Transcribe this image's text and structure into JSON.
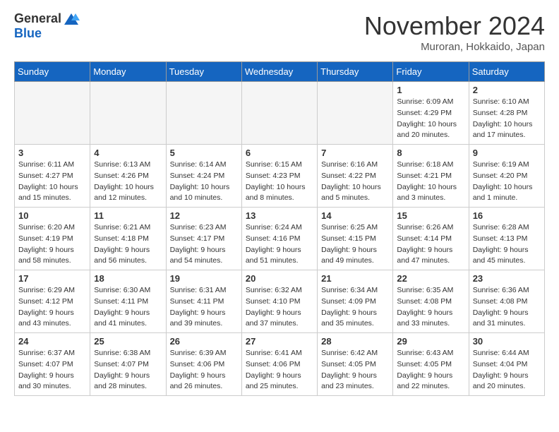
{
  "header": {
    "logo_general": "General",
    "logo_blue": "Blue",
    "month_title": "November 2024",
    "location": "Muroran, Hokkaido, Japan"
  },
  "weekdays": [
    "Sunday",
    "Monday",
    "Tuesday",
    "Wednesday",
    "Thursday",
    "Friday",
    "Saturday"
  ],
  "weeks": [
    [
      {
        "day": "",
        "info": "",
        "empty": true
      },
      {
        "day": "",
        "info": "",
        "empty": true
      },
      {
        "day": "",
        "info": "",
        "empty": true
      },
      {
        "day": "",
        "info": "",
        "empty": true
      },
      {
        "day": "",
        "info": "",
        "empty": true
      },
      {
        "day": "1",
        "info": "Sunrise: 6:09 AM\nSunset: 4:29 PM\nDaylight: 10 hours\nand 20 minutes.",
        "empty": false
      },
      {
        "day": "2",
        "info": "Sunrise: 6:10 AM\nSunset: 4:28 PM\nDaylight: 10 hours\nand 17 minutes.",
        "empty": false
      }
    ],
    [
      {
        "day": "3",
        "info": "Sunrise: 6:11 AM\nSunset: 4:27 PM\nDaylight: 10 hours\nand 15 minutes.",
        "empty": false
      },
      {
        "day": "4",
        "info": "Sunrise: 6:13 AM\nSunset: 4:26 PM\nDaylight: 10 hours\nand 12 minutes.",
        "empty": false
      },
      {
        "day": "5",
        "info": "Sunrise: 6:14 AM\nSunset: 4:24 PM\nDaylight: 10 hours\nand 10 minutes.",
        "empty": false
      },
      {
        "day": "6",
        "info": "Sunrise: 6:15 AM\nSunset: 4:23 PM\nDaylight: 10 hours\nand 8 minutes.",
        "empty": false
      },
      {
        "day": "7",
        "info": "Sunrise: 6:16 AM\nSunset: 4:22 PM\nDaylight: 10 hours\nand 5 minutes.",
        "empty": false
      },
      {
        "day": "8",
        "info": "Sunrise: 6:18 AM\nSunset: 4:21 PM\nDaylight: 10 hours\nand 3 minutes.",
        "empty": false
      },
      {
        "day": "9",
        "info": "Sunrise: 6:19 AM\nSunset: 4:20 PM\nDaylight: 10 hours\nand 1 minute.",
        "empty": false
      }
    ],
    [
      {
        "day": "10",
        "info": "Sunrise: 6:20 AM\nSunset: 4:19 PM\nDaylight: 9 hours\nand 58 minutes.",
        "empty": false
      },
      {
        "day": "11",
        "info": "Sunrise: 6:21 AM\nSunset: 4:18 PM\nDaylight: 9 hours\nand 56 minutes.",
        "empty": false
      },
      {
        "day": "12",
        "info": "Sunrise: 6:23 AM\nSunset: 4:17 PM\nDaylight: 9 hours\nand 54 minutes.",
        "empty": false
      },
      {
        "day": "13",
        "info": "Sunrise: 6:24 AM\nSunset: 4:16 PM\nDaylight: 9 hours\nand 51 minutes.",
        "empty": false
      },
      {
        "day": "14",
        "info": "Sunrise: 6:25 AM\nSunset: 4:15 PM\nDaylight: 9 hours\nand 49 minutes.",
        "empty": false
      },
      {
        "day": "15",
        "info": "Sunrise: 6:26 AM\nSunset: 4:14 PM\nDaylight: 9 hours\nand 47 minutes.",
        "empty": false
      },
      {
        "day": "16",
        "info": "Sunrise: 6:28 AM\nSunset: 4:13 PM\nDaylight: 9 hours\nand 45 minutes.",
        "empty": false
      }
    ],
    [
      {
        "day": "17",
        "info": "Sunrise: 6:29 AM\nSunset: 4:12 PM\nDaylight: 9 hours\nand 43 minutes.",
        "empty": false
      },
      {
        "day": "18",
        "info": "Sunrise: 6:30 AM\nSunset: 4:11 PM\nDaylight: 9 hours\nand 41 minutes.",
        "empty": false
      },
      {
        "day": "19",
        "info": "Sunrise: 6:31 AM\nSunset: 4:11 PM\nDaylight: 9 hours\nand 39 minutes.",
        "empty": false
      },
      {
        "day": "20",
        "info": "Sunrise: 6:32 AM\nSunset: 4:10 PM\nDaylight: 9 hours\nand 37 minutes.",
        "empty": false
      },
      {
        "day": "21",
        "info": "Sunrise: 6:34 AM\nSunset: 4:09 PM\nDaylight: 9 hours\nand 35 minutes.",
        "empty": false
      },
      {
        "day": "22",
        "info": "Sunrise: 6:35 AM\nSunset: 4:08 PM\nDaylight: 9 hours\nand 33 minutes.",
        "empty": false
      },
      {
        "day": "23",
        "info": "Sunrise: 6:36 AM\nSunset: 4:08 PM\nDaylight: 9 hours\nand 31 minutes.",
        "empty": false
      }
    ],
    [
      {
        "day": "24",
        "info": "Sunrise: 6:37 AM\nSunset: 4:07 PM\nDaylight: 9 hours\nand 30 minutes.",
        "empty": false
      },
      {
        "day": "25",
        "info": "Sunrise: 6:38 AM\nSunset: 4:07 PM\nDaylight: 9 hours\nand 28 minutes.",
        "empty": false
      },
      {
        "day": "26",
        "info": "Sunrise: 6:39 AM\nSunset: 4:06 PM\nDaylight: 9 hours\nand 26 minutes.",
        "empty": false
      },
      {
        "day": "27",
        "info": "Sunrise: 6:41 AM\nSunset: 4:06 PM\nDaylight: 9 hours\nand 25 minutes.",
        "empty": false
      },
      {
        "day": "28",
        "info": "Sunrise: 6:42 AM\nSunset: 4:05 PM\nDaylight: 9 hours\nand 23 minutes.",
        "empty": false
      },
      {
        "day": "29",
        "info": "Sunrise: 6:43 AM\nSunset: 4:05 PM\nDaylight: 9 hours\nand 22 minutes.",
        "empty": false
      },
      {
        "day": "30",
        "info": "Sunrise: 6:44 AM\nSunset: 4:04 PM\nDaylight: 9 hours\nand 20 minutes.",
        "empty": false
      }
    ]
  ]
}
